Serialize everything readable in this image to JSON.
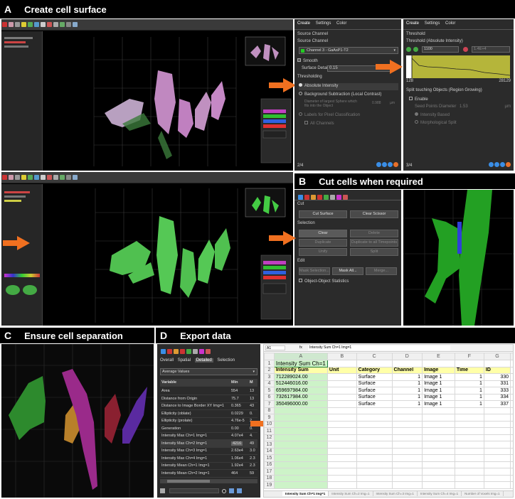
{
  "headers": {
    "a": {
      "letter": "A",
      "title": "Create cell surface"
    },
    "b": {
      "letter": "B",
      "title": "Cut cells when required"
    },
    "c": {
      "letter": "C",
      "title": "Ensure cell separation"
    },
    "d": {
      "letter": "D",
      "title": "Export data"
    }
  },
  "colors": {
    "arrow": "#f07020",
    "magenta_cell": "#c080c0",
    "green_cell": "#50c050",
    "excel_highlight": "#ffffa8",
    "excel_green": "#cdf3c8"
  },
  "create_panel": {
    "tabs": [
      "Create",
      "Settings",
      "Color"
    ],
    "source_channel_section": "Source Channel",
    "source_channel_label": "Source Channel",
    "channel_value": "Channel 3 - GaAsP1-T2",
    "smooth_label": "Smooth",
    "surface_detail_label": "Surface Detail",
    "surface_detail_value": "0.15",
    "surface_detail_unit": "µm",
    "thresholding_label": "Thresholding",
    "absolute_intensity": "Absolute Intensity",
    "background_subtraction": "Background Subtraction (Local Contrast)",
    "diameter_label": "Diameter of largest Sphere which fits into the Object",
    "diameter_value": "0.988",
    "diameter_unit": "µm",
    "pixel_classification": "Labels for Pixel Classification",
    "all_channels": "All Channels",
    "step": "2/4"
  },
  "threshold_panel": {
    "tabs": [
      "Create",
      "Settings",
      "Color"
    ],
    "threshold_section": "Threshold",
    "threshold_label": "Threshold (Absolute Intensity)",
    "threshold_value": "1100",
    "threshold_right": "1.4E+4",
    "hist_min": "128",
    "hist_max": "28129",
    "split_label": "Split touching Objects (Region Growing)",
    "enable_label": "Enable",
    "seed_label": "Seed Points Diameter",
    "seed_value": "1.53",
    "seed_unit": "µm",
    "intensity_based": "Intensity Based",
    "morphological_split": "Morphological Split",
    "step": "3/4"
  },
  "cut_panel": {
    "cut_section": "Cut",
    "cut_surface": "Cut Surface",
    "clear_scissor": "Clear Scissor",
    "selection_section": "Selection",
    "clear": "Clear",
    "delete": "Delete",
    "duplicate": "Duplicate",
    "duplicate_all": "Duplicate to all Timepoints",
    "unify": "Unify",
    "split": "Split",
    "edit_section": "Edit",
    "mask_selection": "Mask Selection...",
    "mask_all": "Mask All...",
    "merge": "Merge...",
    "object_stats": "Object-Object Statistics"
  },
  "stats_panel": {
    "tabs": [
      "Overall",
      "Spatial",
      "Detailed",
      "Selection"
    ],
    "dropdown": "Average Values",
    "columns": [
      "Variable",
      "Min",
      "M"
    ],
    "rows": [
      {
        "name": "Area",
        "min": "554",
        "max": "13"
      },
      {
        "name": "Distance from Origin",
        "min": "75.7",
        "max": "13"
      },
      {
        "name": "Distance to Image Border XY Img=1",
        "min": "0.365",
        "max": "43"
      },
      {
        "name": "Ellipticity (oblate)",
        "min": "0.0229",
        "max": "0."
      },
      {
        "name": "Ellipticity (prolate)",
        "min": "4.76e-5",
        "max": "2."
      },
      {
        "name": "Generation",
        "min": "0.00",
        "max": "0."
      },
      {
        "name": "Intensity Max Ch=1 Img=1",
        "min": "4.07e4",
        "max": "4."
      },
      {
        "name": "Intensity Max Ch=2 Img=1",
        "min": "4216",
        "max": "49"
      },
      {
        "name": "Intensity Max Ch=3 Img=1",
        "min": "2.63e4",
        "max": "3.0"
      },
      {
        "name": "Intensity Max Ch=4 Img=1",
        "min": "1.06e4",
        "max": "2.3"
      },
      {
        "name": "Intensity Mean Ch=1 Img=1",
        "min": "1.92e4",
        "max": "2.3"
      },
      {
        "name": "Intensity Mean Ch=2 Img=1",
        "min": "464",
        "max": "59"
      }
    ]
  },
  "excel": {
    "name_box": "A1",
    "formula": "Intensity Sum Ch=1 Img=1",
    "col_letters": [
      "A",
      "B",
      "C",
      "D",
      "E",
      "F",
      "G"
    ],
    "a1": "Intensity Sum Ch=1",
    "headers": [
      "Intensity Sum",
      "Unit",
      "Category",
      "Channel",
      "Image",
      "Time",
      "ID"
    ],
    "rows": [
      [
        "712289024.00",
        "",
        "Surface",
        "1",
        "Image 1",
        "1",
        "330"
      ],
      [
        "512446016.00",
        "",
        "Surface",
        "1",
        "Image 1",
        "1",
        "331"
      ],
      [
        "659697984.00",
        "",
        "Surface",
        "1",
        "Image 1",
        "1",
        "333"
      ],
      [
        "732617984.00",
        "",
        "Surface",
        "1",
        "Image 1",
        "1",
        "334"
      ],
      [
        "350496000.00",
        "",
        "Surface",
        "1",
        "Image 1",
        "1",
        "337"
      ]
    ],
    "row_numbers": [
      "1",
      "2",
      "3",
      "4",
      "5",
      "6",
      "7",
      "8",
      "9",
      "10",
      "11",
      "12",
      "13",
      "14",
      "15",
      "16",
      "17",
      "18",
      "19"
    ],
    "sheet_tabs": [
      "Intensity Sum Ch=1 Img=1",
      "Intensity Sum Ch=2 Img=1",
      "Intensity Sum Ch=3 Img=1",
      "Intensity Sum Ch=4 Img=1",
      "Number of Voxels Img=1"
    ]
  }
}
